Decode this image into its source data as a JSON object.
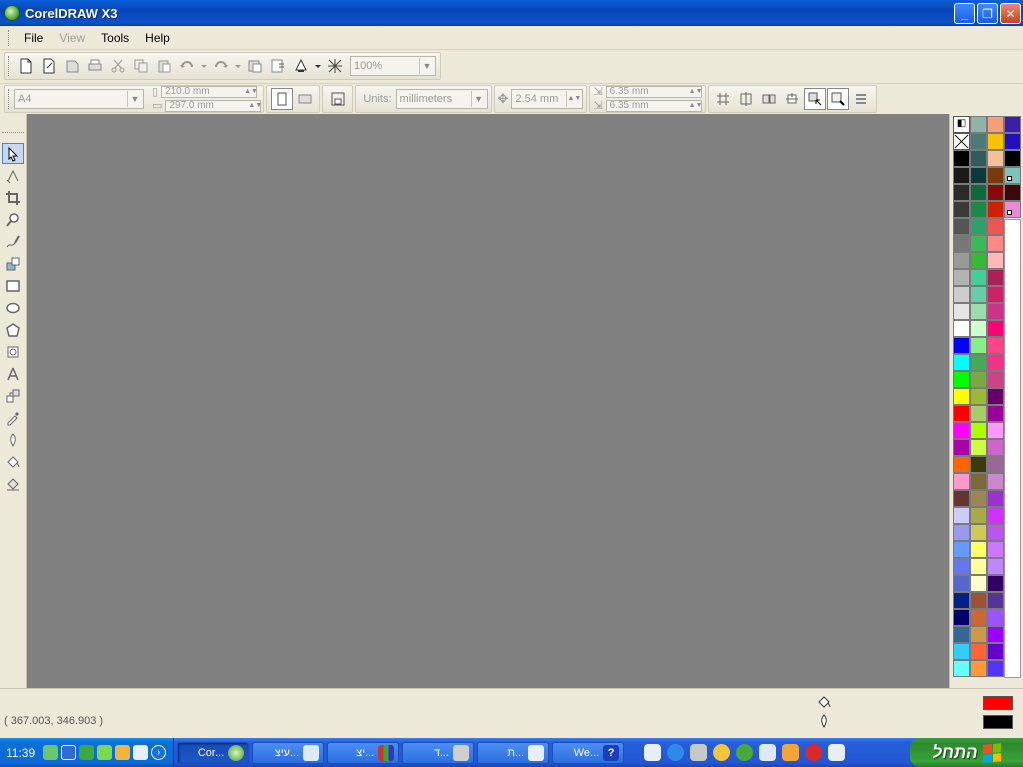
{
  "window": {
    "title": "CorelDRAW X3",
    "minimize": "_",
    "restore": "❐",
    "close": "✕"
  },
  "menu": [
    {
      "label": "File",
      "enabled": true
    },
    {
      "label": "View",
      "enabled": false
    },
    {
      "label": "Tools",
      "enabled": true
    },
    {
      "label": "Help",
      "enabled": true
    }
  ],
  "standard_toolbar": {
    "zoom_value": "100%"
  },
  "property_bar": {
    "paper_size": "A4",
    "width_value": "210.0 mm",
    "height_value": "297.0 mm",
    "units_label": "Units:",
    "units_value": "millimeters",
    "nudge_value": "2.54 mm",
    "duplicate_x": "6.35 mm",
    "duplicate_y": "6.35 mm"
  },
  "palette_colors": [
    [
      "#ffffff",
      "#8fb3a8",
      "#f3a07a",
      "#3b1fa8"
    ],
    [
      "#ffffff",
      "#4a7a7a",
      "#f7c200",
      "#2010c0"
    ],
    [
      "#000000",
      "#2e5c5c",
      "#f3c09a",
      "#000000"
    ],
    [
      "#1a1a1a",
      "#0c3b3b",
      "#7a3a0a",
      "#7fc2b7"
    ],
    [
      "#2a2a2a",
      "#0c6a3b",
      "#8a0a0a",
      "#3a0a0a"
    ],
    [
      "#3a3a3a",
      "#1a8a4a",
      "#cc2200",
      "#e88ad8"
    ],
    [
      "#555555",
      "#2aa26a",
      "#ee5555",
      "#ffffff"
    ],
    [
      "#777777",
      "#3ab85a",
      "#ff8888",
      "#ffffff"
    ],
    [
      "#999999",
      "#33bb33",
      "#ffb8b8",
      "#ffffff"
    ],
    [
      "#b3b3b3",
      "#44cc99",
      "#aa2255",
      "#ffffff"
    ],
    [
      "#cccccc",
      "#66ccaa",
      "#cc2266",
      "#ffffff"
    ],
    [
      "#e5e5e5",
      "#99ddaa",
      "#cc3388",
      "#ffffff"
    ],
    [
      "#ffffff",
      "#ccffcc",
      "#ff0077",
      "#ffffff"
    ],
    [
      "#0000ff",
      "#88ee88",
      "#ff4488",
      "#ffffff"
    ],
    [
      "#00ffff",
      "#44aa55",
      "#ee3388",
      "#ffffff"
    ],
    [
      "#00ff00",
      "#77aa44",
      "#cc4488",
      "#ffffff"
    ],
    [
      "#ffff00",
      "#99bb33",
      "#660066",
      "#ffffff"
    ],
    [
      "#ff0000",
      "#aacc66",
      "#990099",
      "#ffffff"
    ],
    [
      "#ff00ff",
      "#aaff00",
      "#ff99ff",
      "#ffffff"
    ],
    [
      "#aa00aa",
      "#ccff44",
      "#cc66cc",
      "#ffffff"
    ],
    [
      "#ff6600",
      "#3a3a0a",
      "#996699",
      "#ffffff"
    ],
    [
      "#ff99cc",
      "#7a6a3a",
      "#cc88cc",
      "#ffffff"
    ],
    [
      "#663333",
      "#998855",
      "#9933cc",
      "#ffffff"
    ],
    [
      "#ccccff",
      "#aaaa44",
      "#cc33ff",
      "#ffffff"
    ],
    [
      "#9999ee",
      "#cccc55",
      "#bb55ee",
      "#ffffff"
    ],
    [
      "#6699ff",
      "#ffff66",
      "#cc77ff",
      "#ffffff"
    ],
    [
      "#6677ee",
      "#ffff99",
      "#bb88ff",
      "#ffffff"
    ],
    [
      "#5566cc",
      "#ffffcc",
      "#330066",
      "#ffffff"
    ],
    [
      "#002288",
      "#995533",
      "#553399",
      "#ffffff"
    ],
    [
      "#000066",
      "#cc6633",
      "#9955ff",
      "#ffffff"
    ],
    [
      "#336699",
      "#cc9944",
      "#9900ff",
      "#ffffff"
    ],
    [
      "#33ccff",
      "#ff6633",
      "#6600cc",
      "#ffffff"
    ],
    [
      "#66ffff",
      "#ff9933",
      "#5533ff",
      "#ffffff"
    ]
  ],
  "status": {
    "coordinates": "( 367.003, 346.903 )",
    "fill_color": "#ff0000",
    "outline_color": "#000000"
  },
  "taskbar": {
    "clock": "11:39",
    "tasks": [
      {
        "label": "Cor...",
        "active": true
      },
      {
        "label": "עיצ...",
        "active": false
      },
      {
        "label": "יצ...",
        "active": false
      },
      {
        "label": "ד...",
        "active": false
      },
      {
        "label": "ת...",
        "active": false
      },
      {
        "label": "We...",
        "active": false
      }
    ],
    "start_label": "התחל"
  }
}
